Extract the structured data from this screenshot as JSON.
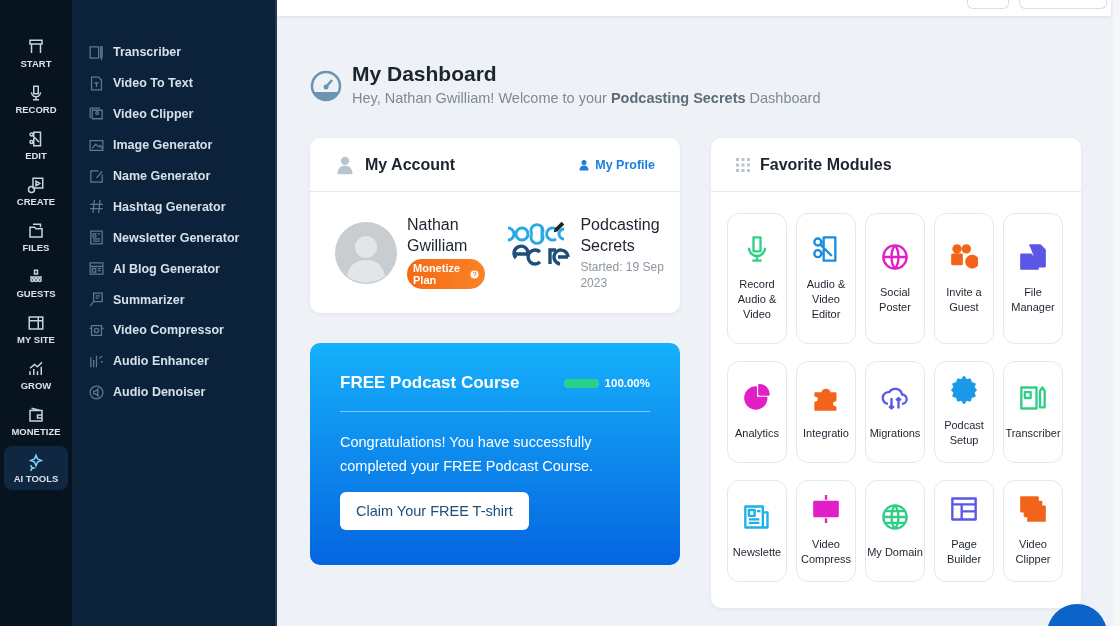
{
  "rail": [
    {
      "label": "START",
      "selected": false
    },
    {
      "label": "RECORD",
      "selected": false
    },
    {
      "label": "EDIT",
      "selected": false
    },
    {
      "label": "CREATE",
      "selected": false
    },
    {
      "label": "FILES",
      "selected": false
    },
    {
      "label": "GUESTS",
      "selected": false
    },
    {
      "label": "MY SITE",
      "selected": false
    },
    {
      "label": "GROW",
      "selected": false
    },
    {
      "label": "MONETIZE",
      "selected": false
    },
    {
      "label": "AI TOOLS",
      "selected": true
    }
  ],
  "submenu": [
    "Transcriber",
    "Video To Text",
    "Video Clipper",
    "Image Generator",
    "Name Generator",
    "Hashtag Generator",
    "Newsletter Generator",
    "AI Blog Generator",
    "Summarizer",
    "Video Compressor",
    "Audio Enhancer",
    "Audio Denoiser"
  ],
  "header": {
    "title": "My Dashboard",
    "subtitle": "Hey, Nathan Gwilliam! Welcome to your **Podcasting Secrets** Dashboard"
  },
  "account": {
    "title": "My Account",
    "profile_link": "My Profile",
    "name": "Nathan Gwilliam",
    "plan_badge": "Monetize Plan",
    "podcast": "Podcasting Secrets",
    "started": "Started: 19 Sep 2023"
  },
  "course": {
    "title": "FREE Podcast Course",
    "level": 1,
    "reading": "100.00%",
    "message": "Congratulations! You have successfully completed your FREE Podcast Course.",
    "button": "Claim Your FREE T-shirt"
  },
  "favorites": {
    "title": "Favorite Modules",
    "modules": [
      {
        "label": "Record Audio & Video"
      },
      {
        "label": "Audio & Video Editor"
      },
      {
        "label": "Social Poster"
      },
      {
        "label": "Invite a Guest"
      },
      {
        "label": "File Manager"
      },
      {
        "label": "Analytics"
      },
      {
        "label": "Integratio"
      },
      {
        "label": "Migrations"
      },
      {
        "label": "Podcast Setup"
      },
      {
        "label": "Transcriber"
      },
      {
        "label": "Newslette"
      },
      {
        "label": "Video Compress"
      },
      {
        "label": "My Domain"
      },
      {
        "label": "Page Builder"
      },
      {
        "label": "Video Clipper"
      }
    ]
  }
}
